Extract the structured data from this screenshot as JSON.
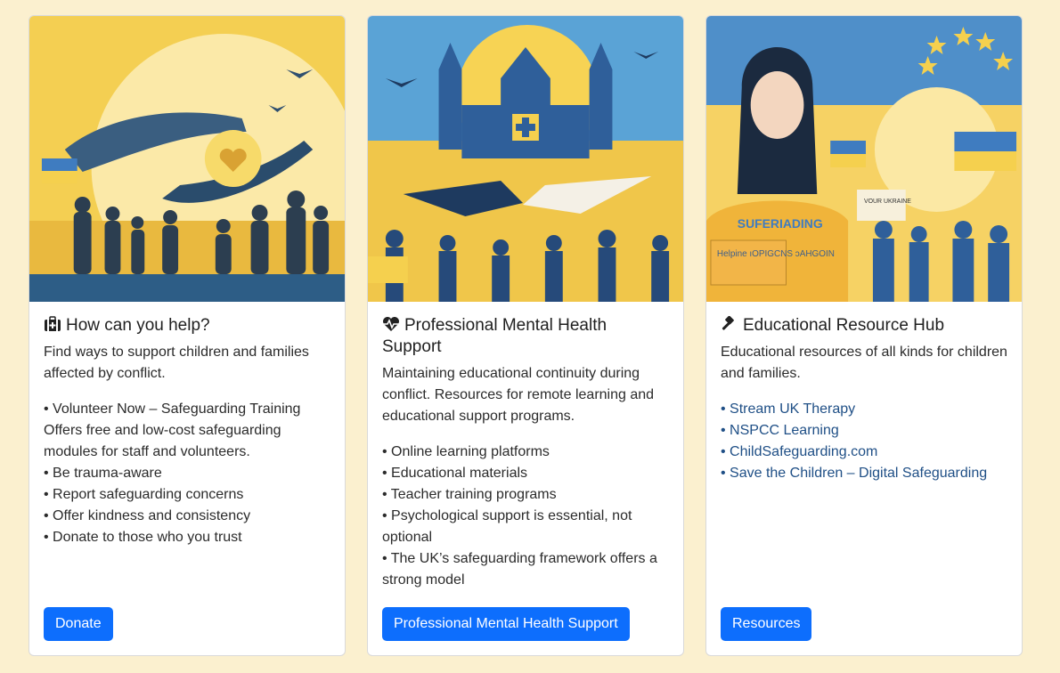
{
  "cards": [
    {
      "icon": "first-aid-kit-icon",
      "title": "How can you help?",
      "text": "Find ways to support children and families affected by conflict.",
      "items": [
        "• Volunteer Now – Safeguarding Training",
        "Offers free and low-cost safeguarding modules for staff and volunteers.",
        "• Be trauma-aware",
        "• Report safeguarding concerns",
        "• Offer kindness and consistency",
        "• Donate to those who you trust"
      ],
      "button": "Donate"
    },
    {
      "icon": "heart-pulse-icon",
      "title": "Professional Mental Health Support",
      "text": "Maintaining educational continuity during conflict. Resources for remote learning and educational support programs.",
      "items": [
        "• Online learning platforms",
        "• Educational materials",
        "• Teacher training programs",
        "• Psychological support is essential, not optional",
        "• The UK’s safeguarding framework offers a strong model"
      ],
      "button": "Professional Mental Health Support"
    },
    {
      "icon": "gavel-icon",
      "title": "Educational Resource Hub",
      "text": "Educational resources of all kinds for children and families.",
      "links": [
        "• Stream UK Therapy",
        "• NSPCC Learning",
        "• ChildSafeguarding.com",
        "• Save the Children – Digital Safeguarding"
      ],
      "button": "Resources"
    }
  ],
  "illustrations": {
    "card1_text": "",
    "card3_shirt": "SUFERIADING",
    "card3_box": "Helpine ıOPIGCNS ɔAHGOIN",
    "card3_sign": "VOUR UKRAINE"
  },
  "colors": {
    "background": "#fbf0cf",
    "button": "#0d6efd",
    "link": "#1f4f86",
    "yellow": "#f5d04e",
    "blue": "#2f6fa6"
  }
}
